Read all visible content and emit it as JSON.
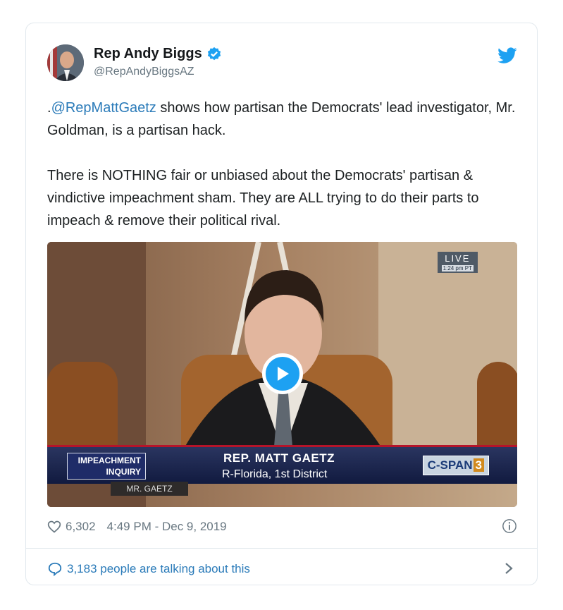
{
  "author": {
    "display_name": "Rep Andy Biggs",
    "handle": "@RepAndyBiggsAZ",
    "avatar": "avatar-photo",
    "verified": true
  },
  "tweet": {
    "prefix": ".",
    "mention": "@RepMattGaetz",
    "line1_rest": " shows how partisan the Democrats' lead investigator, Mr. Goldman, is a partisan hack.",
    "paragraph2": "There is NOTHING fair or unbiased about the Democrats' partisan & vindictive impeachment sham. They are ALL trying to do their parts to impeach & remove their political rival."
  },
  "media": {
    "live_label": "LIVE",
    "live_time": "1:24 pm PT",
    "chyron_left_line1": "IMPEACHMENT",
    "chyron_left_line2": "INQUIRY",
    "chyron_name": "REP. MATT GAETZ",
    "chyron_sub": "R-Florida, 1st District",
    "network": "C-SPAN",
    "network_number": "3",
    "nameplate": "MR. GAETZ",
    "play_icon": "play-icon"
  },
  "footer": {
    "likes": "6,302",
    "timestamp": "4:49 PM - Dec 9, 2019",
    "talking": "3,183 people are talking about this"
  },
  "colors": {
    "accent": "#1da1f2",
    "link": "#2b7bb9",
    "muted": "#697882"
  }
}
